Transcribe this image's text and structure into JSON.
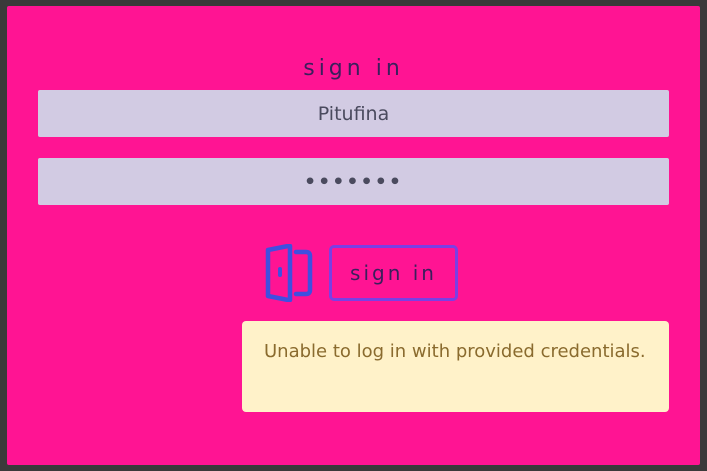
{
  "form": {
    "title": "sign in",
    "username_value": "Pitufina",
    "password_value": "•••••••",
    "submit_label": "sign in"
  },
  "alert": {
    "message": "Unable to log in with provided credentials."
  },
  "icons": {
    "door": "door-icon"
  },
  "colors": {
    "card_background": "#ff1493",
    "input_background": "#d2cbe3",
    "button_border": "#7b3fe4",
    "icon_color": "#3f4fe0",
    "alert_background": "#fff2c9",
    "alert_text": "#8a6b2e"
  }
}
